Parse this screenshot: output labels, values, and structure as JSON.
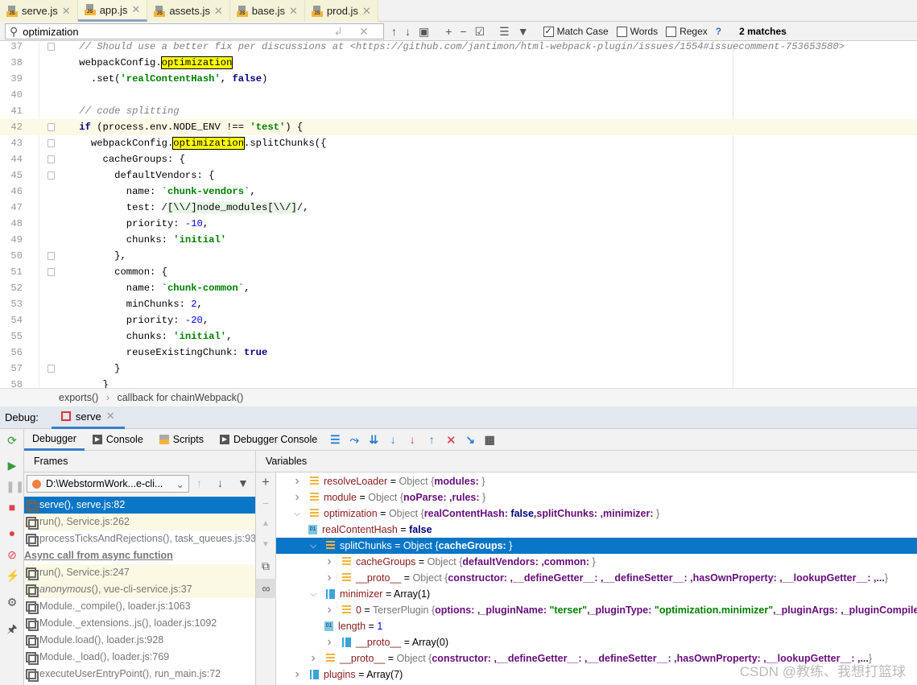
{
  "tabs": [
    {
      "label": "serve.js"
    },
    {
      "label": "app.js",
      "active": true
    },
    {
      "label": "assets.js"
    },
    {
      "label": "base.js"
    },
    {
      "label": "prod.js"
    }
  ],
  "search": {
    "value": "optimization",
    "match_case": {
      "label": "Match Case",
      "checked": true
    },
    "words": {
      "label": "Words",
      "checked": false
    },
    "regex": {
      "label": "Regex",
      "checked": false
    },
    "help": "?",
    "matches": "2 matches"
  },
  "editor": {
    "current_line": 42,
    "lines": [
      {
        "n": "37",
        "t": [
          [
            "    ",
            ""
          ],
          [
            "// Should use a better fix per discussions at <https://github.com/jantimon/html-webpack-plugin/issues/1554#issuecomment-753653580>",
            "com"
          ]
        ],
        "fold": true
      },
      {
        "n": "38",
        "t": [
          [
            "    webpackConfig.",
            ""
          ],
          [
            "optimization",
            "hl"
          ]
        ]
      },
      {
        "n": "39",
        "t": [
          [
            "      .set(",
            ""
          ],
          [
            "'realContentHash'",
            "str"
          ],
          [
            ", ",
            ""
          ],
          [
            "false",
            "kw"
          ],
          [
            ")",
            ""
          ]
        ]
      },
      {
        "n": "40",
        "t": []
      },
      {
        "n": "41",
        "t": [
          [
            "    ",
            ""
          ],
          [
            "// code splitting",
            "com"
          ]
        ]
      },
      {
        "n": "42",
        "t": [
          [
            "    ",
            ""
          ],
          [
            "if",
            "kw"
          ],
          [
            " (process.env.NODE_ENV !== ",
            ""
          ],
          [
            "'test'",
            "str"
          ],
          [
            ") {",
            ""
          ]
        ],
        "fold": true
      },
      {
        "n": "43",
        "t": [
          [
            "      webpackConfig.",
            ""
          ],
          [
            "optimization",
            "hl"
          ],
          [
            ".splitChunks({",
            ""
          ]
        ],
        "fold": true
      },
      {
        "n": "44",
        "t": [
          [
            "        cacheGroups: {",
            ""
          ]
        ],
        "fold": true
      },
      {
        "n": "45",
        "t": [
          [
            "          defaultVendors: {",
            ""
          ]
        ],
        "fold": true
      },
      {
        "n": "46",
        "t": [
          [
            "            name: ",
            ""
          ],
          [
            "`chunk-vendors`",
            "str"
          ],
          [
            ",",
            ""
          ]
        ]
      },
      {
        "n": "47",
        "t": [
          [
            "            test: /",
            ""
          ],
          [
            "[\\\\/]node_modules[\\\\/]",
            "rx"
          ],
          [
            "/,",
            ""
          ]
        ]
      },
      {
        "n": "48",
        "t": [
          [
            "            priority: ",
            ""
          ],
          [
            "-10",
            "num"
          ],
          [
            ",",
            ""
          ]
        ]
      },
      {
        "n": "49",
        "t": [
          [
            "            chunks: ",
            ""
          ],
          [
            "'initial'",
            "str"
          ]
        ]
      },
      {
        "n": "50",
        "t": [
          [
            "          },",
            ""
          ]
        ],
        "fold": true
      },
      {
        "n": "51",
        "t": [
          [
            "          common: {",
            ""
          ]
        ],
        "fold": true
      },
      {
        "n": "52",
        "t": [
          [
            "            name: ",
            ""
          ],
          [
            "`chunk-common`",
            "str"
          ],
          [
            ",",
            ""
          ]
        ]
      },
      {
        "n": "53",
        "t": [
          [
            "            minChunks: ",
            ""
          ],
          [
            "2",
            "num"
          ],
          [
            ",",
            ""
          ]
        ]
      },
      {
        "n": "54",
        "t": [
          [
            "            priority: ",
            ""
          ],
          [
            "-20",
            "num"
          ],
          [
            ",",
            ""
          ]
        ]
      },
      {
        "n": "55",
        "t": [
          [
            "            chunks: ",
            ""
          ],
          [
            "'initial'",
            "str"
          ],
          [
            ",",
            ""
          ]
        ]
      },
      {
        "n": "56",
        "t": [
          [
            "            reuseExistingChunk: ",
            ""
          ],
          [
            "true",
            "kw"
          ]
        ]
      },
      {
        "n": "57",
        "t": [
          [
            "          }",
            ""
          ]
        ],
        "fold": true
      },
      {
        "n": "58",
        "t": [
          [
            "        }",
            ""
          ]
        ]
      }
    ]
  },
  "breadcrumb": [
    "exports()",
    "callback for chainWebpack()"
  ],
  "debug": {
    "label": "Debug:",
    "session": "serve"
  },
  "debug_tabs": [
    {
      "label": "Debugger",
      "active": true
    },
    {
      "label": "Console"
    },
    {
      "label": "Scripts"
    },
    {
      "label": "Debugger Console"
    }
  ],
  "frames": {
    "header": "Frames",
    "thread": "D:\\WebstormWork...e-cli...",
    "items": [
      {
        "label": "serve(), serve.js:82",
        "state": "sel"
      },
      {
        "label": "run(), Service.js:262",
        "state": "y"
      },
      {
        "label": "processTicksAndRejections(), task_queues.js:93",
        "state": ""
      },
      {
        "label": "Async call from async function",
        "state": "async"
      },
      {
        "label": "run(), Service.js:247",
        "state": "y"
      },
      {
        "label": "anonymous(), vue-cli-service.js:37",
        "state": "y",
        "italic": "anonymous"
      },
      {
        "label": "Module._compile(), loader.js:1063",
        "state": ""
      },
      {
        "label": "Module._extensions..js(), loader.js:1092",
        "state": ""
      },
      {
        "label": "Module.load(), loader.js:928",
        "state": ""
      },
      {
        "label": "Module._load(), loader.js:769",
        "state": ""
      },
      {
        "label": "executeUserEntryPoint(), run_main.js:72",
        "state": ""
      }
    ]
  },
  "variables": {
    "header": "Variables",
    "items": [
      {
        "d": 0,
        "exp": "closed",
        "icon": "obj",
        "parts": [
          [
            "resolveLoader",
            "vn"
          ],
          [
            " = ",
            ""
          ],
          [
            "Object ",
            "vty"
          ],
          [
            "{",
            "vty"
          ],
          [
            "modules: ",
            "vb"
          ],
          [
            "}",
            "vty"
          ]
        ]
      },
      {
        "d": 0,
        "exp": "closed",
        "icon": "obj",
        "parts": [
          [
            "module",
            "vn"
          ],
          [
            " = ",
            ""
          ],
          [
            "Object ",
            "vty"
          ],
          [
            "{",
            "vty"
          ],
          [
            "noParse: ,rules: ",
            "vb"
          ],
          [
            "}",
            "vty"
          ]
        ]
      },
      {
        "d": 0,
        "exp": "open",
        "icon": "obj",
        "parts": [
          [
            "optimization",
            "vn"
          ],
          [
            " = ",
            ""
          ],
          [
            "Object ",
            "vty"
          ],
          [
            "{",
            "vty"
          ],
          [
            "realContentHash: ",
            "vb"
          ],
          [
            "false",
            "vk"
          ],
          [
            ",splitChunks: ,minimizer: ",
            "vb"
          ],
          [
            "}",
            "vty"
          ]
        ]
      },
      {
        "d": 1,
        "exp": "none",
        "icon": "prim",
        "parts": [
          [
            "realContentHash",
            "vn"
          ],
          [
            " = ",
            ""
          ],
          [
            "false",
            "vk"
          ]
        ]
      },
      {
        "d": 1,
        "exp": "open",
        "icon": "obj",
        "sel": true,
        "parts": [
          [
            "splitChunks",
            "vn"
          ],
          [
            " = ",
            ""
          ],
          [
            "Object ",
            "vty"
          ],
          [
            "{",
            "vty"
          ],
          [
            "cacheGroups: ",
            "vb"
          ],
          [
            "}",
            "vty"
          ]
        ]
      },
      {
        "d": 2,
        "exp": "closed",
        "icon": "obj",
        "parts": [
          [
            "cacheGroups",
            "vn"
          ],
          [
            " = ",
            ""
          ],
          [
            "Object ",
            "vty"
          ],
          [
            "{",
            "vty"
          ],
          [
            "defaultVendors: ,common: ",
            "vb"
          ],
          [
            "}",
            "vty"
          ]
        ]
      },
      {
        "d": 2,
        "exp": "closed",
        "icon": "obj",
        "parts": [
          [
            "__proto__",
            "vn"
          ],
          [
            " = ",
            ""
          ],
          [
            "Object ",
            "vty"
          ],
          [
            "{",
            "vty"
          ],
          [
            "constructor: ,__defineGetter__: ,__defineSetter__: ,hasOwnProperty: ,__lookupGetter__: ,...",
            "vb"
          ],
          [
            "}",
            "vty"
          ]
        ]
      },
      {
        "d": 1,
        "exp": "open",
        "icon": "arr",
        "parts": [
          [
            "minimizer",
            "vn"
          ],
          [
            " = ",
            ""
          ],
          [
            "Array(1)",
            ""
          ]
        ]
      },
      {
        "d": 2,
        "exp": "closed",
        "icon": "obj",
        "parts": [
          [
            "0",
            "vn"
          ],
          [
            " = ",
            ""
          ],
          [
            "TerserPlugin ",
            "vty"
          ],
          [
            "{",
            "vty"
          ],
          [
            "options: ,_pluginName: ",
            "vb"
          ],
          [
            "\"terser\"",
            "vs"
          ],
          [
            ",_pluginType: ",
            "vb"
          ],
          [
            "\"optimization.minimizer\"",
            "vs"
          ],
          [
            ",_pluginArgs: ,_pluginCompiler: ",
            "vb"
          ]
        ]
      },
      {
        "d": 2,
        "exp": "none",
        "icon": "prim",
        "parts": [
          [
            "length",
            "vn"
          ],
          [
            " = ",
            ""
          ],
          [
            "1",
            "vnum"
          ]
        ]
      },
      {
        "d": 2,
        "exp": "closed",
        "icon": "arr",
        "parts": [
          [
            "__proto__",
            "vn"
          ],
          [
            " = ",
            ""
          ],
          [
            "Array(0)",
            ""
          ]
        ]
      },
      {
        "d": 1,
        "exp": "closed",
        "icon": "obj",
        "parts": [
          [
            "__proto__",
            "vn"
          ],
          [
            " = ",
            ""
          ],
          [
            "Object ",
            "vty"
          ],
          [
            "{",
            "vty"
          ],
          [
            "constructor: ,__defineGetter__: ,__defineSetter__: ,hasOwnProperty: ,__lookupGetter__: ,...",
            "vb"
          ],
          [
            "}",
            "vty"
          ]
        ]
      },
      {
        "d": 0,
        "exp": "closed",
        "icon": "arr",
        "parts": [
          [
            "plugins",
            "vn"
          ],
          [
            " = ",
            ""
          ],
          [
            "Array(7)",
            ""
          ]
        ]
      }
    ]
  },
  "watermark": "CSDN @教练、我想打篮球",
  "colors": {
    "selection": "#0a76c6",
    "match_highlight": "#ffff00",
    "tab_bg": "#f4f3d8"
  }
}
